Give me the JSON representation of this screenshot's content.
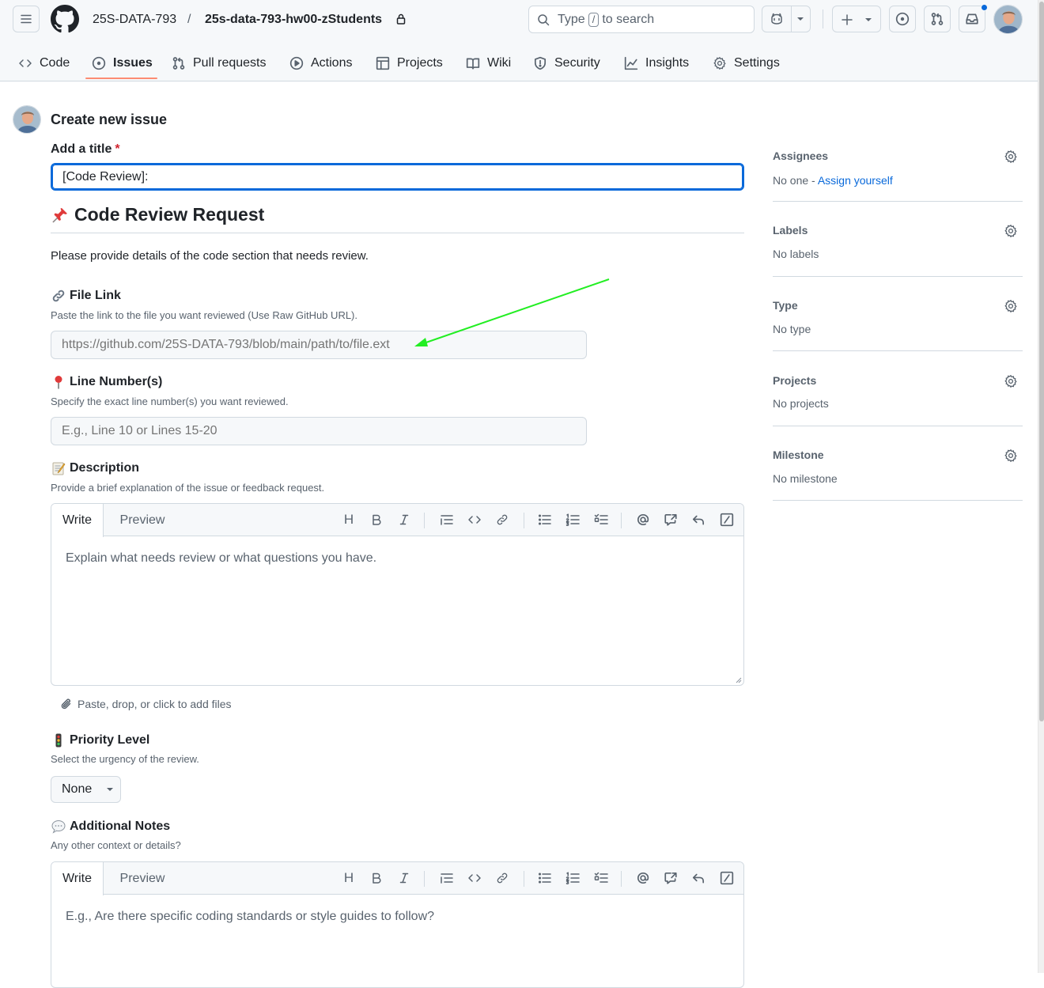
{
  "header": {
    "owner": "25S-DATA-793",
    "separator": "/",
    "repo": "25s-data-793-hw00-zStudents",
    "search": {
      "prefix": "Type",
      "key": "/",
      "suffix": "to search"
    }
  },
  "tabs": [
    {
      "label": "Code",
      "icon": "code-icon"
    },
    {
      "label": "Issues",
      "icon": "issue-opened-icon",
      "active": true
    },
    {
      "label": "Pull requests",
      "icon": "git-pull-request-icon"
    },
    {
      "label": "Actions",
      "icon": "play-icon"
    },
    {
      "label": "Projects",
      "icon": "table-icon"
    },
    {
      "label": "Wiki",
      "icon": "book-icon"
    },
    {
      "label": "Security",
      "icon": "shield-icon"
    },
    {
      "label": "Insights",
      "icon": "graph-icon"
    },
    {
      "label": "Settings",
      "icon": "gear-icon"
    }
  ],
  "form": {
    "page_title": "Create new issue",
    "title_label": "Add a title",
    "required_mark": "*",
    "title_value": "[Code Review]: ",
    "heading": "Code Review Request",
    "intro": "Please provide details of the code section that needs review.",
    "file_link": {
      "label": "File Link",
      "hint": "Paste the link to the file you want reviewed (Use Raw GitHub URL).",
      "placeholder": "https://github.com/25S-DATA-793/blob/main/path/to/file.ext"
    },
    "line_numbers": {
      "label": "Line Number(s)",
      "hint": "Specify the exact line number(s) you want reviewed.",
      "placeholder": "E.g., Line 10 or Lines 15-20"
    },
    "description": {
      "label": "Description",
      "hint": "Provide a brief explanation of the issue or feedback request.",
      "write_tab": "Write",
      "preview_tab": "Preview",
      "placeholder": "Explain what needs review or what questions you have."
    },
    "attach_text": "Paste, drop, or click to add files",
    "priority": {
      "label": "Priority Level",
      "hint": "Select the urgency of the review.",
      "selected": "None"
    },
    "notes": {
      "label": "Additional Notes",
      "hint": "Any other context or details?",
      "write_tab": "Write",
      "preview_tab": "Preview",
      "placeholder": "E.g., Are there specific coding standards or style guides to follow?"
    },
    "toolbar_heading_glyph": "H"
  },
  "sidebar": {
    "assignees": {
      "title": "Assignees",
      "value": "No one - ",
      "link": "Assign yourself"
    },
    "labels": {
      "title": "Labels",
      "value": "No labels"
    },
    "type": {
      "title": "Type",
      "value": "No type"
    },
    "projects": {
      "title": "Projects",
      "value": "No projects"
    },
    "milestone": {
      "title": "Milestone",
      "value": "No milestone"
    }
  },
  "colors": {
    "accent": "#0969da",
    "active_tab_underline": "#fd8c73",
    "annotation_arrow": "#22ee22",
    "required": "#d1242f"
  }
}
